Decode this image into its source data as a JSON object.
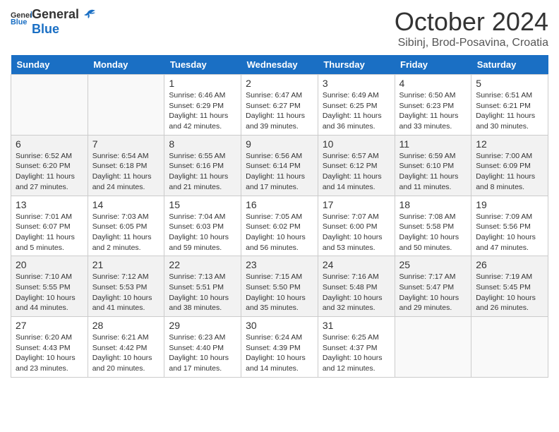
{
  "header": {
    "logo_general": "General",
    "logo_blue": "Blue",
    "month_title": "October 2024",
    "location": "Sibinj, Brod-Posavina, Croatia"
  },
  "days_of_week": [
    "Sunday",
    "Monday",
    "Tuesday",
    "Wednesday",
    "Thursday",
    "Friday",
    "Saturday"
  ],
  "weeks": [
    [
      {
        "day": "",
        "info": ""
      },
      {
        "day": "",
        "info": ""
      },
      {
        "day": "1",
        "info": "Sunrise: 6:46 AM\nSunset: 6:29 PM\nDaylight: 11 hours and 42 minutes."
      },
      {
        "day": "2",
        "info": "Sunrise: 6:47 AM\nSunset: 6:27 PM\nDaylight: 11 hours and 39 minutes."
      },
      {
        "day": "3",
        "info": "Sunrise: 6:49 AM\nSunset: 6:25 PM\nDaylight: 11 hours and 36 minutes."
      },
      {
        "day": "4",
        "info": "Sunrise: 6:50 AM\nSunset: 6:23 PM\nDaylight: 11 hours and 33 minutes."
      },
      {
        "day": "5",
        "info": "Sunrise: 6:51 AM\nSunset: 6:21 PM\nDaylight: 11 hours and 30 minutes."
      }
    ],
    [
      {
        "day": "6",
        "info": "Sunrise: 6:52 AM\nSunset: 6:20 PM\nDaylight: 11 hours and 27 minutes."
      },
      {
        "day": "7",
        "info": "Sunrise: 6:54 AM\nSunset: 6:18 PM\nDaylight: 11 hours and 24 minutes."
      },
      {
        "day": "8",
        "info": "Sunrise: 6:55 AM\nSunset: 6:16 PM\nDaylight: 11 hours and 21 minutes."
      },
      {
        "day": "9",
        "info": "Sunrise: 6:56 AM\nSunset: 6:14 PM\nDaylight: 11 hours and 17 minutes."
      },
      {
        "day": "10",
        "info": "Sunrise: 6:57 AM\nSunset: 6:12 PM\nDaylight: 11 hours and 14 minutes."
      },
      {
        "day": "11",
        "info": "Sunrise: 6:59 AM\nSunset: 6:10 PM\nDaylight: 11 hours and 11 minutes."
      },
      {
        "day": "12",
        "info": "Sunrise: 7:00 AM\nSunset: 6:09 PM\nDaylight: 11 hours and 8 minutes."
      }
    ],
    [
      {
        "day": "13",
        "info": "Sunrise: 7:01 AM\nSunset: 6:07 PM\nDaylight: 11 hours and 5 minutes."
      },
      {
        "day": "14",
        "info": "Sunrise: 7:03 AM\nSunset: 6:05 PM\nDaylight: 11 hours and 2 minutes."
      },
      {
        "day": "15",
        "info": "Sunrise: 7:04 AM\nSunset: 6:03 PM\nDaylight: 10 hours and 59 minutes."
      },
      {
        "day": "16",
        "info": "Sunrise: 7:05 AM\nSunset: 6:02 PM\nDaylight: 10 hours and 56 minutes."
      },
      {
        "day": "17",
        "info": "Sunrise: 7:07 AM\nSunset: 6:00 PM\nDaylight: 10 hours and 53 minutes."
      },
      {
        "day": "18",
        "info": "Sunrise: 7:08 AM\nSunset: 5:58 PM\nDaylight: 10 hours and 50 minutes."
      },
      {
        "day": "19",
        "info": "Sunrise: 7:09 AM\nSunset: 5:56 PM\nDaylight: 10 hours and 47 minutes."
      }
    ],
    [
      {
        "day": "20",
        "info": "Sunrise: 7:10 AM\nSunset: 5:55 PM\nDaylight: 10 hours and 44 minutes."
      },
      {
        "day": "21",
        "info": "Sunrise: 7:12 AM\nSunset: 5:53 PM\nDaylight: 10 hours and 41 minutes."
      },
      {
        "day": "22",
        "info": "Sunrise: 7:13 AM\nSunset: 5:51 PM\nDaylight: 10 hours and 38 minutes."
      },
      {
        "day": "23",
        "info": "Sunrise: 7:15 AM\nSunset: 5:50 PM\nDaylight: 10 hours and 35 minutes."
      },
      {
        "day": "24",
        "info": "Sunrise: 7:16 AM\nSunset: 5:48 PM\nDaylight: 10 hours and 32 minutes."
      },
      {
        "day": "25",
        "info": "Sunrise: 7:17 AM\nSunset: 5:47 PM\nDaylight: 10 hours and 29 minutes."
      },
      {
        "day": "26",
        "info": "Sunrise: 7:19 AM\nSunset: 5:45 PM\nDaylight: 10 hours and 26 minutes."
      }
    ],
    [
      {
        "day": "27",
        "info": "Sunrise: 6:20 AM\nSunset: 4:43 PM\nDaylight: 10 hours and 23 minutes."
      },
      {
        "day": "28",
        "info": "Sunrise: 6:21 AM\nSunset: 4:42 PM\nDaylight: 10 hours and 20 minutes."
      },
      {
        "day": "29",
        "info": "Sunrise: 6:23 AM\nSunset: 4:40 PM\nDaylight: 10 hours and 17 minutes."
      },
      {
        "day": "30",
        "info": "Sunrise: 6:24 AM\nSunset: 4:39 PM\nDaylight: 10 hours and 14 minutes."
      },
      {
        "day": "31",
        "info": "Sunrise: 6:25 AM\nSunset: 4:37 PM\nDaylight: 10 hours and 12 minutes."
      },
      {
        "day": "",
        "info": ""
      },
      {
        "day": "",
        "info": ""
      }
    ]
  ]
}
